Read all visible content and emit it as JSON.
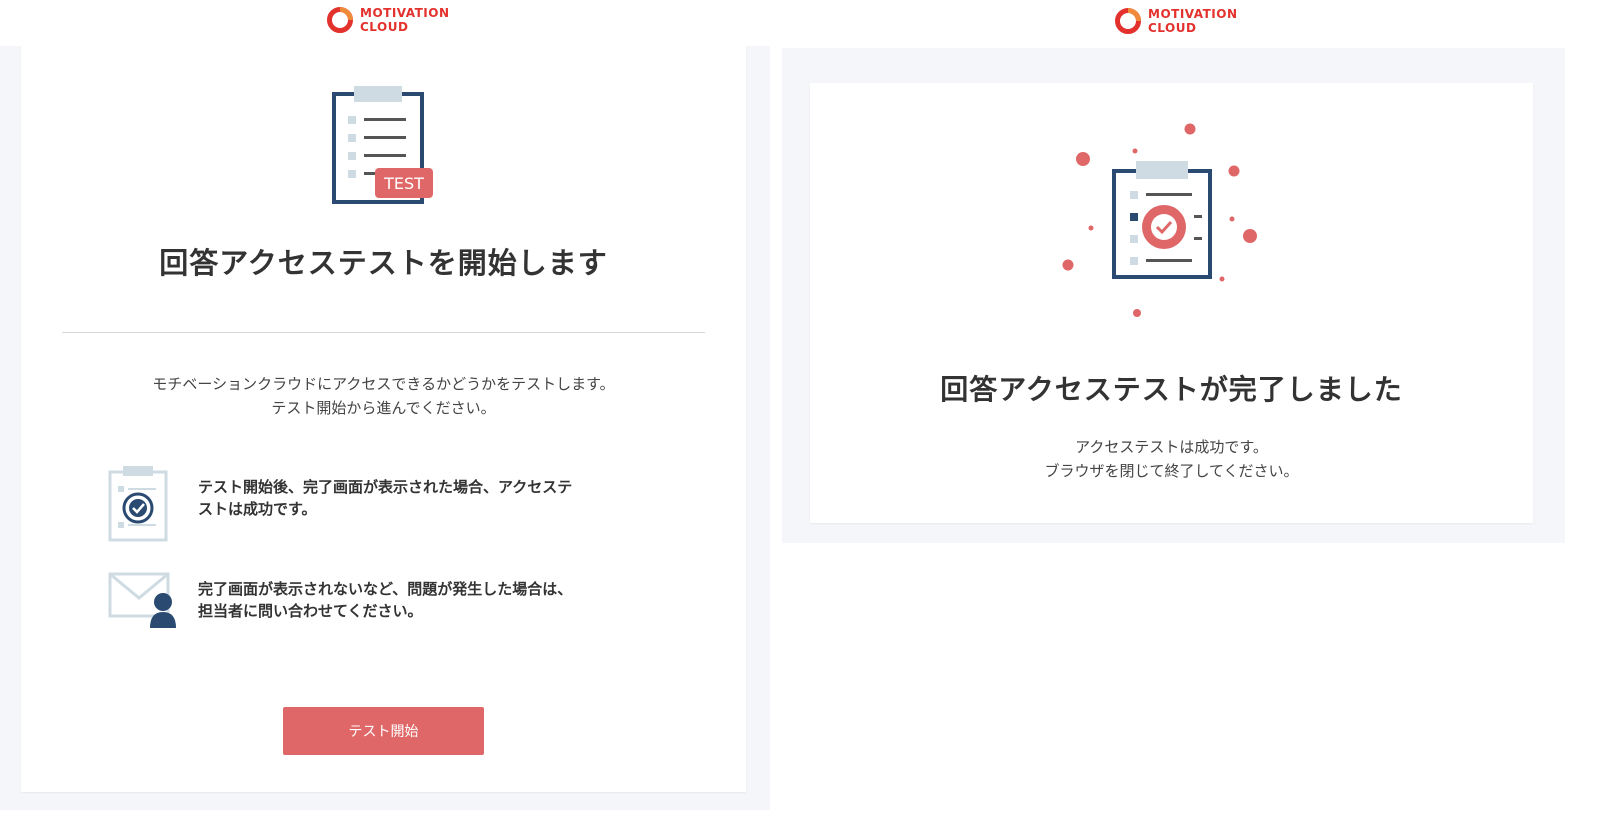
{
  "brand": {
    "line1": "MOTIVATION",
    "line2": "CLOUD",
    "color": "#e3312d"
  },
  "left": {
    "badge": "TEST",
    "title": "回答アクセステストを開始します",
    "intro_line1": "モチベーションクラウドにアクセスできるかどうかをテストします。",
    "intro_line2": "テスト開始から進んでください。",
    "info": [
      {
        "icon": "clipboard-check-icon",
        "line1": "テスト開始後、完了画面が表示された場合、アクセステ",
        "line2": "ストは成功です。"
      },
      {
        "icon": "mail-person-icon",
        "line1": "完了画面が表示されないなど、問題が発生した場合は、",
        "line2": "担当者に問い合わせてください。"
      }
    ],
    "button_label": "テスト開始"
  },
  "right": {
    "title": "回答アクセステストが完了しました",
    "result_line1": "アクセステストは成功です。",
    "result_line2": "ブラウザを閉じて終了してください。"
  },
  "colors": {
    "accent": "#e06767",
    "navy": "#2b4a72",
    "light_blue": "#cfdbe3",
    "background": "#f5f6fa"
  }
}
